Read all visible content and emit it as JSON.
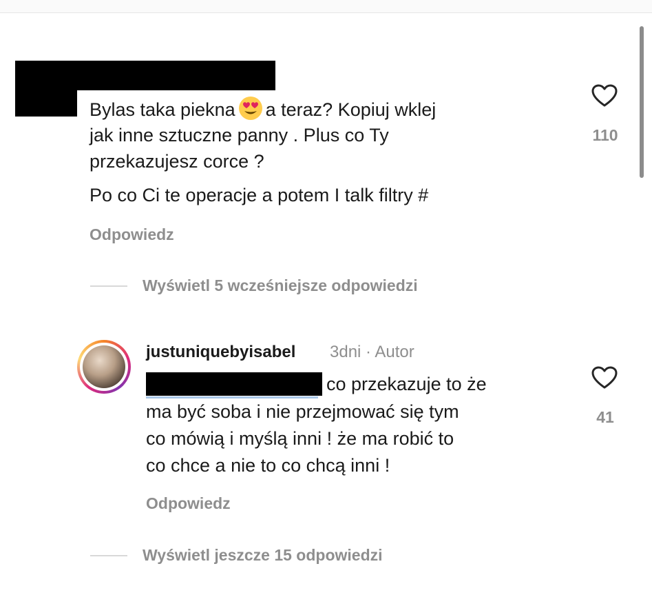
{
  "comment": {
    "text_line1_a": "Bylas taka piekna",
    "text_line1_b": "a teraz? Kopiuj wklej",
    "text_line2": "jak inne sztuczne panny . Plus co Ty",
    "text_line3": "przekazujesz corce ?",
    "text_line4": "Po co Ci te operacje a potem I talk filtry #",
    "reply_label": "Odpowiedz",
    "likes": "110",
    "emoji": "heart-eyes-emoji"
  },
  "view_earlier": {
    "label": "Wyświetl 5 wcześniejsze odpowiedzi"
  },
  "reply": {
    "username": "justuniquebyisabel",
    "meta": "3dni · Autor",
    "text_line1": "co przekazuje to że",
    "text_line2": "ma być soba i nie przejmować się tym",
    "text_line3": "co mówią i myślą inni ! że ma robić to",
    "text_line4": "co chce a nie to co chcą inni !",
    "reply_label": "Odpowiedz",
    "likes": "41"
  },
  "view_more": {
    "label": "Wyświetl jeszcze 15 odpowiedzi"
  },
  "colors": {
    "muted": "#8e8e8e",
    "text": "#1a1a1a",
    "redaction": "#000000"
  }
}
